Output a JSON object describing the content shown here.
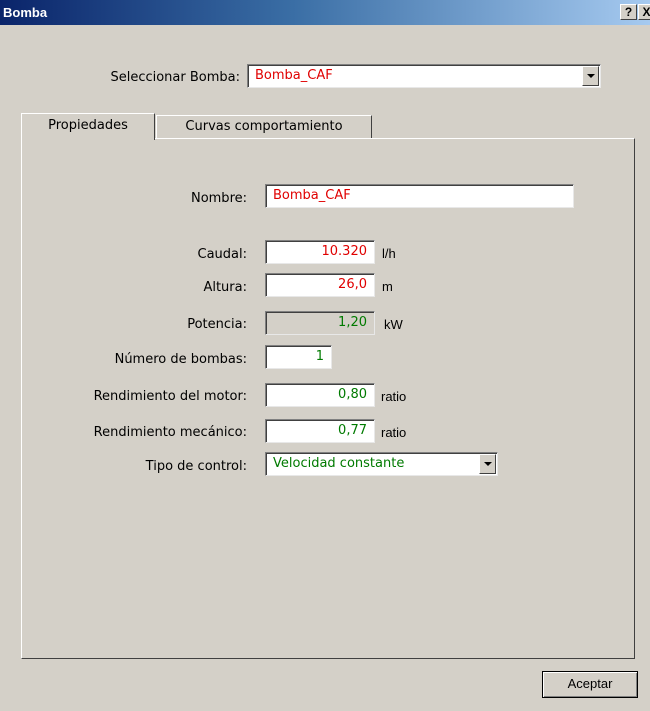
{
  "window": {
    "title": "Bomba",
    "help_label": "?",
    "close_label": "X"
  },
  "selector": {
    "label": "Seleccionar Bomba:",
    "value": "Bomba_CAF"
  },
  "tabs": [
    {
      "label": "Propiedades"
    },
    {
      "label": "Curvas comportamiento"
    }
  ],
  "form": {
    "nombre": {
      "label": "Nombre:",
      "value": "Bomba_CAF"
    },
    "caudal": {
      "label": "Caudal:",
      "value": "10.320",
      "unit": "l/h"
    },
    "altura": {
      "label": "Altura:",
      "value": "26,0",
      "unit": "m"
    },
    "potencia": {
      "label": "Potencia:",
      "value": "1,20",
      "unit": "kW"
    },
    "numero_bombas": {
      "label": "Número de bombas:",
      "value": "1"
    },
    "rend_motor": {
      "label": "Rendimiento del motor:",
      "value": "0,80",
      "unit": "ratio"
    },
    "rend_mecanico": {
      "label": "Rendimiento mecánico:",
      "value": "0,77",
      "unit": "ratio"
    },
    "tipo_control": {
      "label": "Tipo de control:",
      "value": "Velocidad constante"
    }
  },
  "buttons": {
    "accept": "Aceptar"
  },
  "colors": {
    "user_value": "#e00000",
    "computed_value": "#007a00",
    "face": "#d4d0c8"
  }
}
